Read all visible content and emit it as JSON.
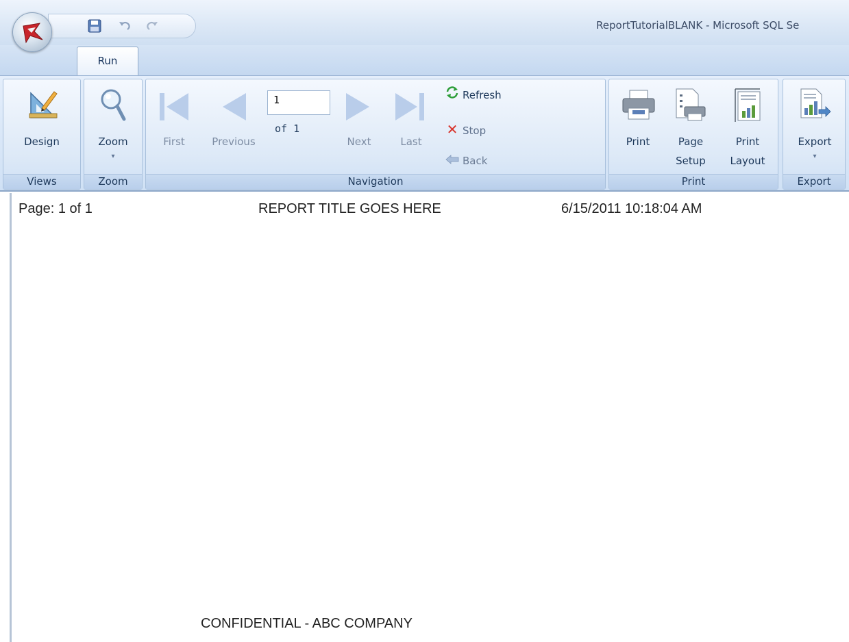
{
  "window": {
    "title": "ReportTutorialBLANK - Microsoft SQL Se"
  },
  "quick_access": {
    "icons": [
      "save-icon",
      "undo-icon",
      "redo-icon"
    ]
  },
  "tabs": [
    {
      "label": "Run",
      "selected": true
    }
  ],
  "ribbon": {
    "views": {
      "group_label": "Views",
      "design_label": "Design"
    },
    "zoom": {
      "group_label": "Zoom",
      "zoom_label": "Zoom"
    },
    "navigation": {
      "group_label": "Navigation",
      "first_label": "First",
      "previous_label": "Previous",
      "page_value": "1",
      "of_text": "of 1",
      "next_label": "Next",
      "last_label": "Last",
      "refresh_label": "Refresh",
      "stop_label": "Stop",
      "back_label": "Back"
    },
    "print": {
      "group_label": "Print",
      "print_label": "Print",
      "page_setup_line1": "Page",
      "page_setup_line2": "Setup",
      "print_layout_line1": "Print",
      "print_layout_line2": "Layout"
    },
    "export": {
      "group_label": "Export",
      "export_label": "Export"
    }
  },
  "report": {
    "page_info": "Page: 1 of 1",
    "title": "REPORT TITLE GOES HERE",
    "timestamp": "6/15/2011 10:18:04 AM",
    "footer": "CONFIDENTIAL - ABC COMPANY"
  },
  "colors": {
    "ribbon_text": "#1e395b",
    "disabled_nav": "#b9cdea",
    "refresh_green": "#2e9e3a",
    "stop_red": "#d8332b"
  }
}
